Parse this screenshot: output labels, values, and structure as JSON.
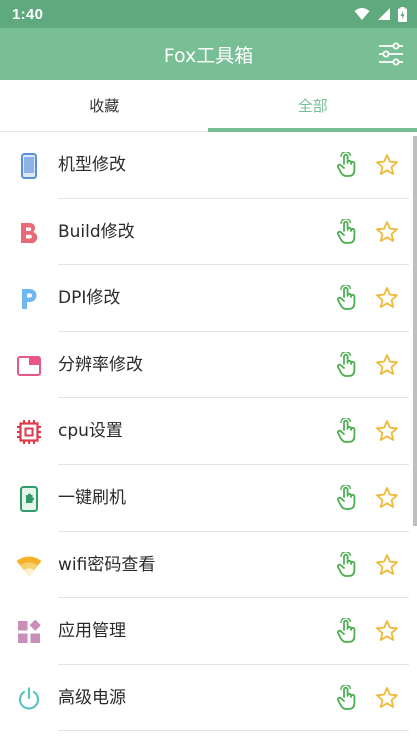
{
  "status": {
    "time": "1:40"
  },
  "app": {
    "title": "Fox工具箱"
  },
  "tabs": [
    {
      "label": "收藏",
      "active": false
    },
    {
      "label": "全部",
      "active": true
    }
  ],
  "items": [
    {
      "label": "机型修改",
      "icon": "phone-icon"
    },
    {
      "label": "Build修改",
      "icon": "letter-b-icon"
    },
    {
      "label": "DPI修改",
      "icon": "letter-p-icon"
    },
    {
      "label": "分辨率修改",
      "icon": "window-icon"
    },
    {
      "label": "cpu设置",
      "icon": "chip-icon"
    },
    {
      "label": "一键刷机",
      "icon": "phone-puzzle-icon"
    },
    {
      "label": "wifi密码查看",
      "icon": "wifi-icon"
    },
    {
      "label": "应用管理",
      "icon": "apps-icon"
    },
    {
      "label": "高级电源",
      "icon": "power-icon"
    }
  ],
  "colors": {
    "accent": "#79bf95",
    "statusbar": "#5fa97e",
    "hand": "#4caf50",
    "star": "#f0b93a"
  }
}
